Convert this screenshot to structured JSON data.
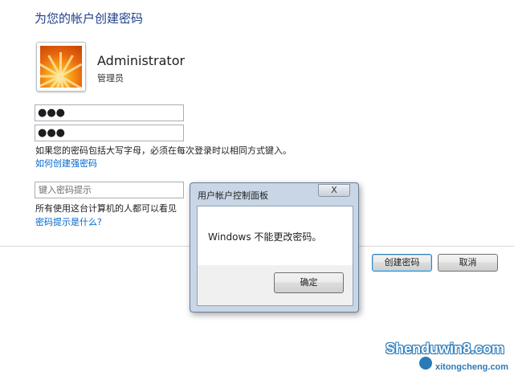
{
  "heading": "为您的帐户创建密码",
  "user": {
    "name": "Administrator",
    "role": "管理员"
  },
  "fields": {
    "new_password": "●●●",
    "confirm_password": "●●●",
    "hint_placeholder": "键入密码提示"
  },
  "text": {
    "case_warning": "如果您的密码包括大写字母，必须在每次登录时以相同方式键入。",
    "strong_password_link": "如何创建强密码",
    "hint_notice": "所有使用这台计算机的人都可以看见",
    "hint_help_link": "密码提示是什么?"
  },
  "buttons": {
    "create": "创建密码",
    "cancel": "取消"
  },
  "dialog": {
    "title": "用户帐户控制面板",
    "close": "X",
    "message": "Windows 不能更改密码。",
    "ok": "确定"
  },
  "watermark": {
    "main": "Shenduwin8.com",
    "sub": "xitongcheng.com"
  },
  "colors": {
    "heading": "#1e3f8a",
    "link": "#0066cc",
    "dialog_frame": "#c8d6e6"
  }
}
